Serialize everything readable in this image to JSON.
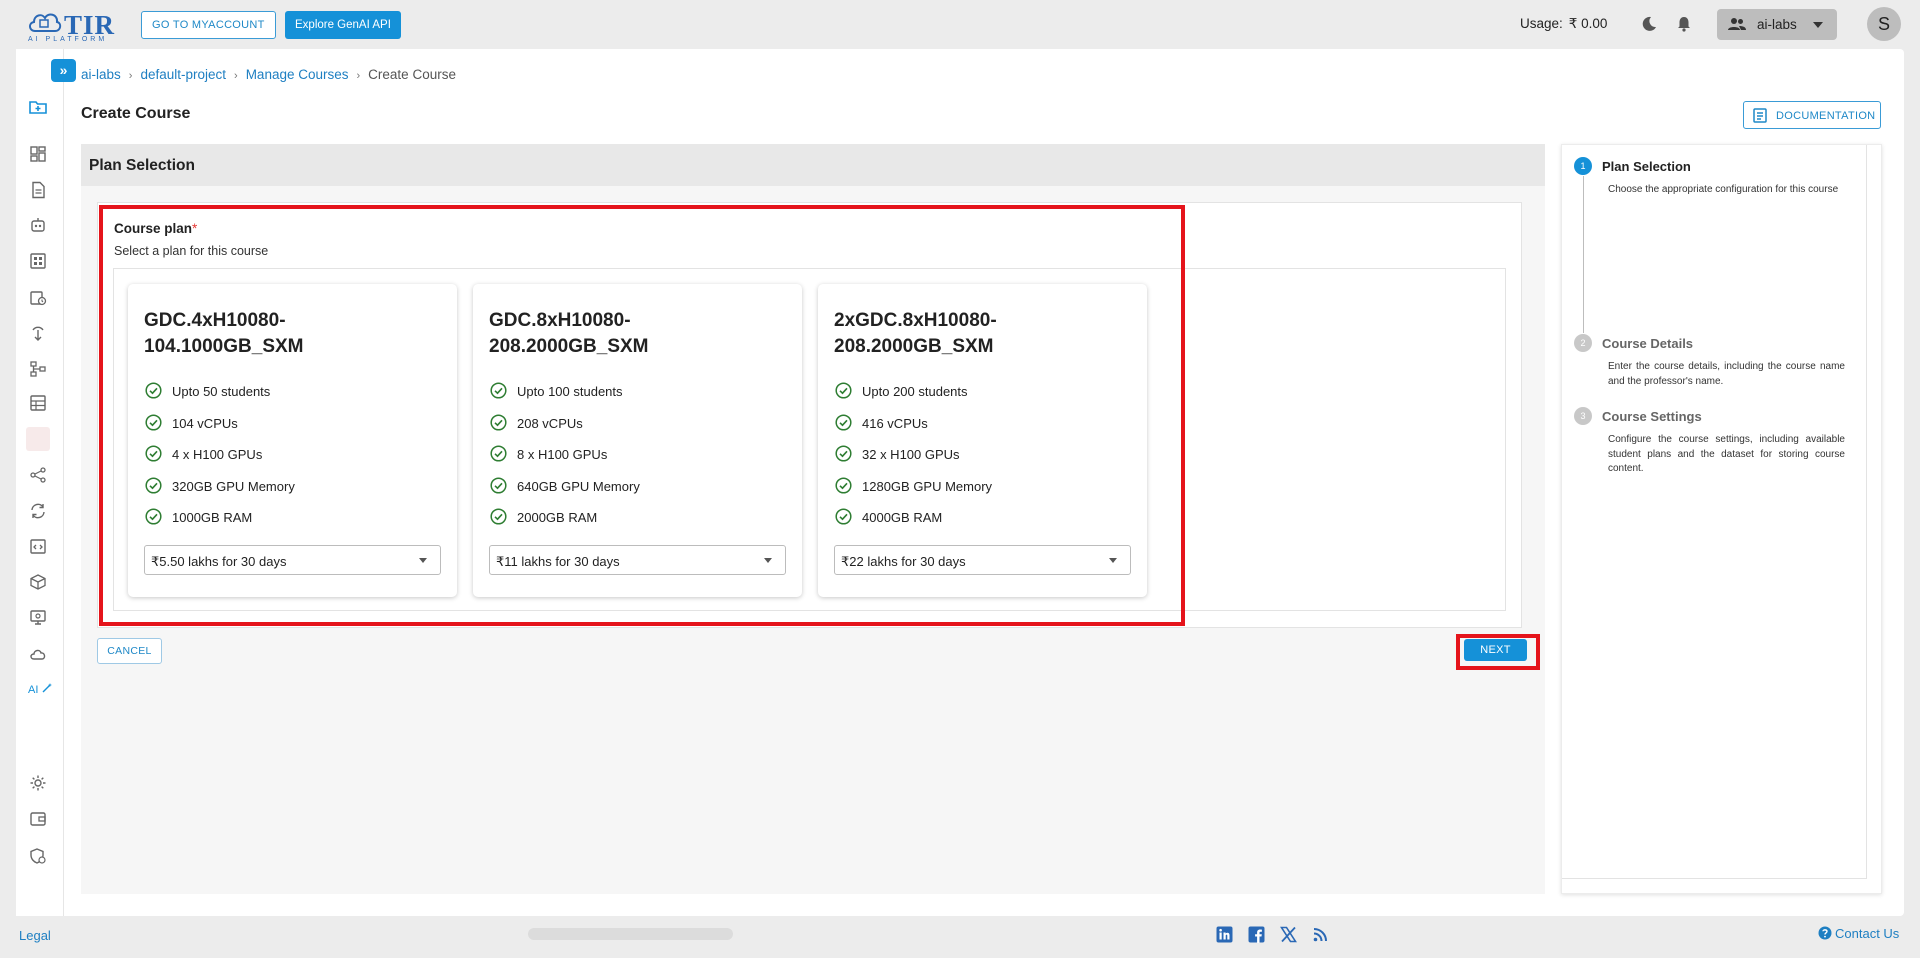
{
  "header": {
    "logo_text": "TIR",
    "logo_subtext": "AI PLATFORM",
    "myaccount_label": "GO TO MYACCOUNT",
    "genai_label": "Explore GenAI API",
    "usage_label": "Usage:",
    "usage_value": "₹ 0.00",
    "project_label": "ai-labs",
    "avatar_initial": "S"
  },
  "sidebar": {
    "toggle": "»",
    "ai_label": "AI"
  },
  "breadcrumb": [
    "ai-labs",
    "default-project",
    "Manage Courses",
    "Create Course"
  ],
  "page": {
    "title": "Create Course",
    "documentation_label": "DOCUMENTATION",
    "section_title": "Plan Selection"
  },
  "form": {
    "field_label": "Course plan",
    "required_mark": "*",
    "field_help": "Select a plan for this course",
    "cancel_label": "CANCEL",
    "next_label": "NEXT"
  },
  "plans": [
    {
      "name_line1": "GDC.4xH10080-",
      "name_line2": "104.1000GB_SXM",
      "features": [
        "Upto 50 students",
        "104 vCPUs",
        "4 x H100 GPUs",
        "320GB GPU Memory",
        "1000GB RAM"
      ],
      "price": "₹5.50 lakhs for 30 days"
    },
    {
      "name_line1": "GDC.8xH10080-",
      "name_line2": "208.2000GB_SXM",
      "features": [
        "Upto 100 students",
        "208 vCPUs",
        "8 x H100 GPUs",
        "640GB GPU Memory",
        "2000GB RAM"
      ],
      "price": "₹11 lakhs for 30 days"
    },
    {
      "name_line1": "2xGDC.8xH10080-",
      "name_line2": "208.2000GB_SXM",
      "features": [
        "Upto 200 students",
        "416 vCPUs",
        "32 x H100 GPUs",
        "1280GB GPU Memory",
        "4000GB RAM"
      ],
      "price": "₹22 lakhs for 30 days"
    }
  ],
  "steps": [
    {
      "num": "1",
      "title": "Plan Selection",
      "desc": "Choose the appropriate configuration for this course",
      "state": "active"
    },
    {
      "num": "2",
      "title": "Course Details",
      "desc": "Enter the course details, including the course name and the professor's name.",
      "state": "inactive"
    },
    {
      "num": "3",
      "title": "Course Settings",
      "desc": "Configure the course settings, including available student plans and the dataset for storing course content.",
      "state": "inactive"
    }
  ],
  "footer": {
    "legal_label": "Legal",
    "contact_label": "Contact Us",
    "social_icons": [
      "linkedin-icon",
      "facebook-icon",
      "x-icon",
      "rss-icon"
    ]
  },
  "colors": {
    "accent": "#1591d8",
    "highlight": "#e5141b",
    "check": "#2e7d32"
  }
}
